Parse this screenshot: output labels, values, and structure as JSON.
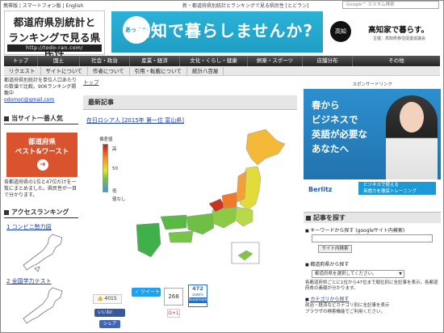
{
  "topbar": {
    "links": [
      "携帯版",
      "スマートフォン版",
      "English"
    ],
    "tagline": "新・都道府県別統計とランキングで見る県民性 [とどラン]",
    "search_placeholder": "Google™ カスタム検索"
  },
  "logo": {
    "line1": "都道府県別統計と",
    "line2": "ランキングで見る県民性",
    "url": "http://todo-ran.com/"
  },
  "banner": {
    "bubble": "あったか",
    "headline": "高知で暮らしませんか?",
    "seal": "高知",
    "title": "高知家で暮らす。",
    "subtitle": "主催：高知県移住促進協議会"
  },
  "nav": {
    "items": [
      "トップ",
      "国土",
      "社会・政治",
      "産業・経済",
      "文化・くらし・健康",
      "娯楽・スポーツ",
      "店舗分布",
      "その他"
    ]
  },
  "subnav": {
    "items": [
      "リクエスト",
      "サイトについて",
      "作者について",
      "引用・転載について",
      "統計八百屋"
    ]
  },
  "left": {
    "intro": "都道府県別統計を単位人口あたりの数値で比較。906ランキング掲載中",
    "contact": "odomori@gmail.com",
    "popular_heading": "当サイト一番人気",
    "best_line1": "都道府県",
    "best_line2": "ベスト&ワースト",
    "best_arrow": "➜",
    "desc": "各都道府県の1位と47位だけを一覧にまとめました。県民性が一目で分かります。",
    "ranking_heading": "アクセスランキング",
    "ranking_items": [
      "1 コンビニ勢力図",
      "2 全国学力テスト"
    ]
  },
  "center": {
    "breadcrumb": "トップ",
    "section": "最新記事",
    "article": "在日ロシア人 [2015年 第一位 富山県]",
    "legend": {
      "title": "偏差値",
      "high": "高",
      "mid": "50",
      "low": "低",
      "none": "値なし"
    }
  },
  "share": {
    "like_count": "4015",
    "tweet_label": "ツイート",
    "tweet_count": "268",
    "hatena_count": "472",
    "hatena_unit": "users",
    "bookmark_label": "Bookmark",
    "fb_like_label": "いいね!",
    "gplus_label": "G+1",
    "share_label": "シェア"
  },
  "right": {
    "sponsor": "スポンサードリンク",
    "ad": {
      "line1": "春から",
      "line2": "ビジネスで",
      "line3": "英語が必要な",
      "line4": "あなたへ",
      "brand": "Berlitz",
      "cta_line1": "ビジネスで使える",
      "cta_line2": "英語力を徹底トレーニング"
    },
    "search_heading": "記事を探す",
    "keyword_label": "キーワードから探す (googleサイト内検索)",
    "search_button": "サイト内検索",
    "pref_label": "都道府県から探す",
    "pref_select": "都道府県を選択してください。",
    "pref_note": "各都道府県ごとに1位から47位まで順位別に全記事を表示。各都道府県の素顔が分かります。",
    "cat_label": "カテゴリから探す",
    "cat_note": "政治・経済などカテゴリ別に全記事を表示",
    "cat_note2": "ブラウザの検索機能でご利用ください。"
  },
  "colors": {
    "nav_bg": "#333333",
    "accent_link": "#1a3fb0",
    "best_box": "#d9532f",
    "banner": "#1f9ec6"
  }
}
